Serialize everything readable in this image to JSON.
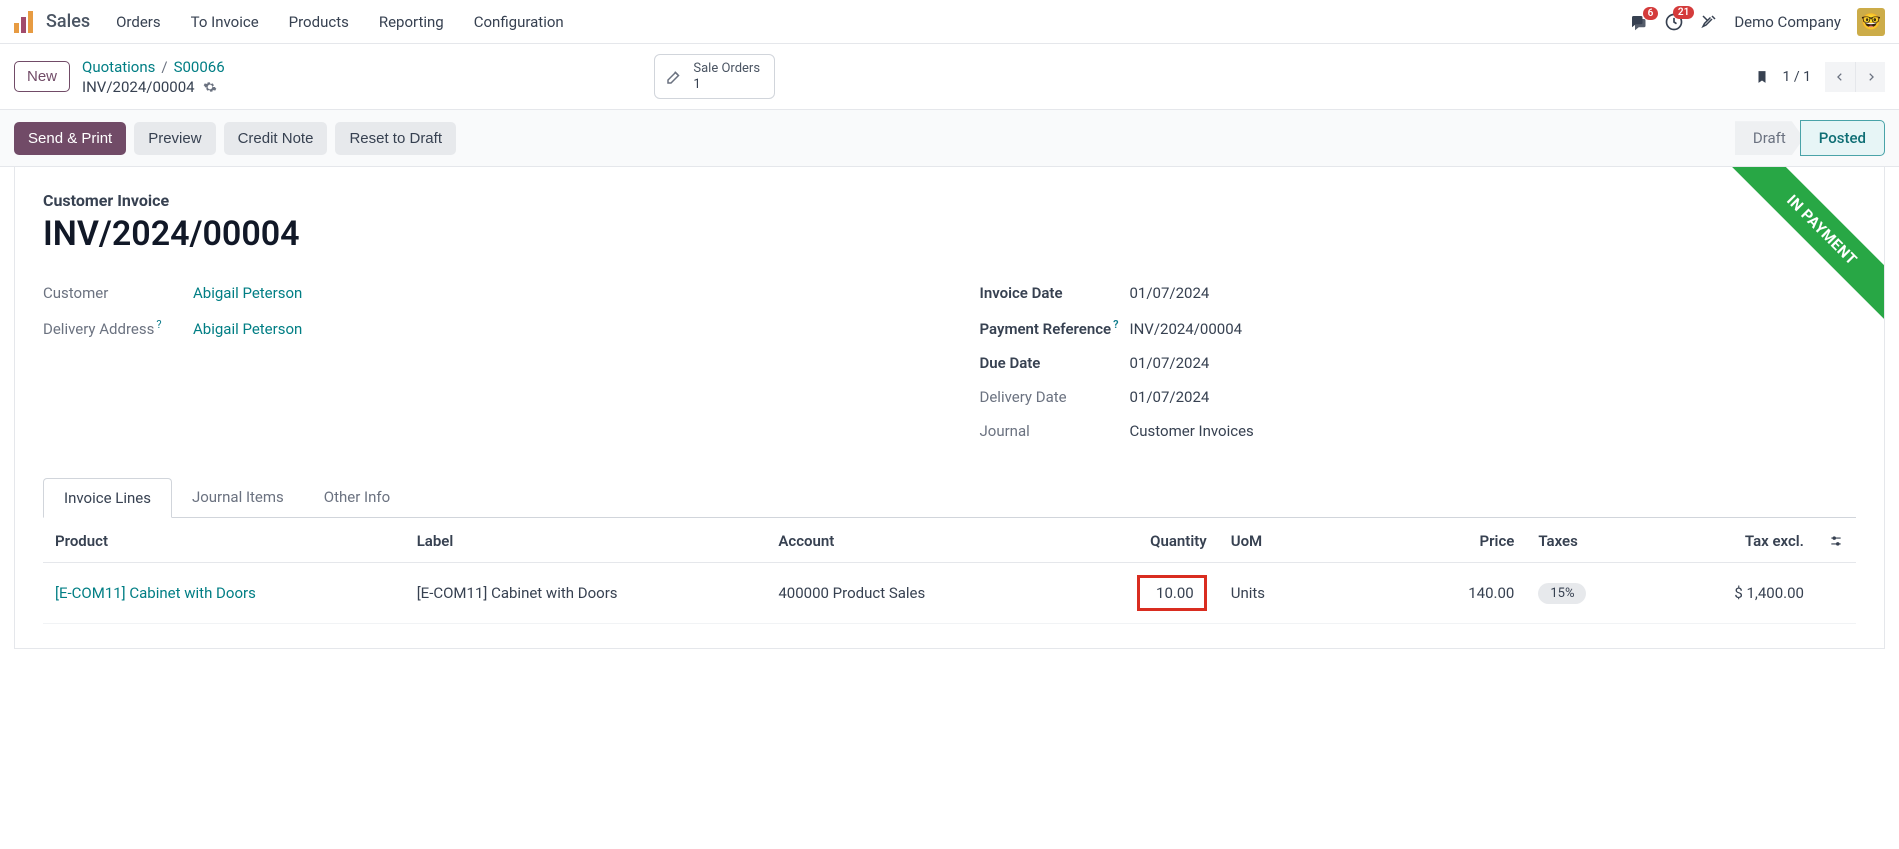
{
  "nav": {
    "brand": "Sales",
    "menu": [
      "Orders",
      "To Invoice",
      "Products",
      "Reporting",
      "Configuration"
    ],
    "chat_badge": "6",
    "activity_badge": "21",
    "company": "Demo Company"
  },
  "header": {
    "new_btn": "New",
    "breadcrumb": {
      "l1": "Quotations",
      "l2": "S00066"
    },
    "doc_ref": "INV/2024/00004",
    "smart": {
      "label": "Sale Orders",
      "count": "1"
    },
    "pager": "1 / 1"
  },
  "actions": {
    "send_print": "Send & Print",
    "preview": "Preview",
    "credit_note": "Credit Note",
    "reset_draft": "Reset to Draft",
    "status_draft": "Draft",
    "status_posted": "Posted"
  },
  "form": {
    "ribbon": "IN PAYMENT",
    "doc_type": "Customer Invoice",
    "doc_title": "INV/2024/00004",
    "left": {
      "customer_label": "Customer",
      "customer_value": "Abigail Peterson",
      "delivery_addr_label": "Delivery Address",
      "delivery_addr_value": "Abigail Peterson"
    },
    "right": {
      "invoice_date_label": "Invoice Date",
      "invoice_date_value": "01/07/2024",
      "payment_ref_label": "Payment Reference",
      "payment_ref_value": "INV/2024/00004",
      "due_date_label": "Due Date",
      "due_date_value": "01/07/2024",
      "delivery_date_label": "Delivery Date",
      "delivery_date_value": "01/07/2024",
      "journal_label": "Journal",
      "journal_value": "Customer Invoices"
    }
  },
  "tabs": {
    "t1": "Invoice Lines",
    "t2": "Journal Items",
    "t3": "Other Info"
  },
  "table": {
    "headers": {
      "product": "Product",
      "label": "Label",
      "account": "Account",
      "quantity": "Quantity",
      "uom": "UoM",
      "price": "Price",
      "taxes": "Taxes",
      "tax_excl": "Tax excl."
    },
    "row": {
      "product": "[E-COM11] Cabinet with Doors",
      "label": "[E-COM11] Cabinet with Doors",
      "account": "400000 Product Sales",
      "quantity": "10.00",
      "uom": "Units",
      "price": "140.00",
      "taxes": "15%",
      "tax_excl": "$ 1,400.00"
    }
  }
}
